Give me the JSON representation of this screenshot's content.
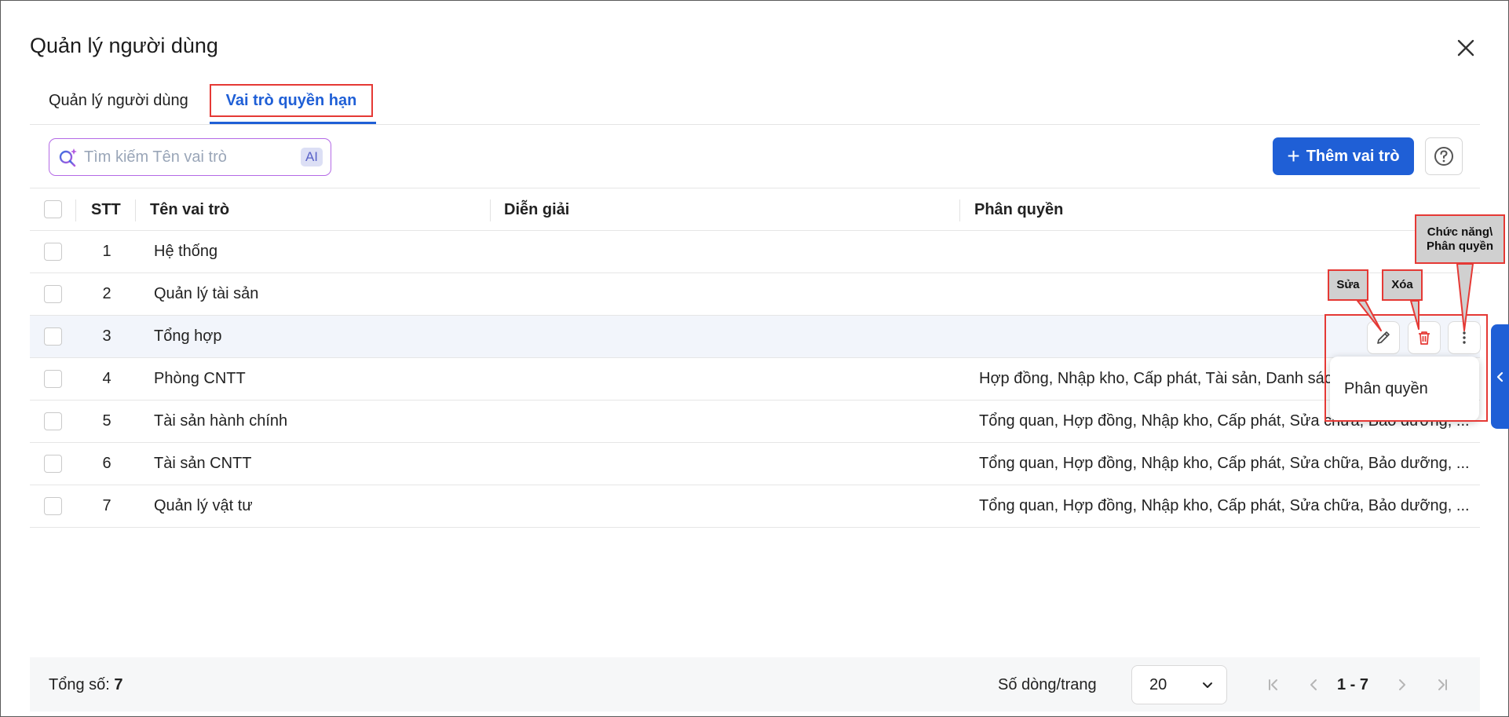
{
  "dialog": {
    "title": "Quản lý người dùng"
  },
  "tabs": [
    {
      "label": "Quản lý người dùng",
      "active": false
    },
    {
      "label": "Vai trò quyền hạn",
      "active": true
    }
  ],
  "search": {
    "placeholder": "Tìm kiếm Tên vai trò",
    "value": "",
    "ai_badge": "AI"
  },
  "toolbar": {
    "add_label": "Thêm vai trò"
  },
  "table": {
    "columns": [
      "STT",
      "Tên vai trò",
      "Diễn giải",
      "Phân quyền"
    ],
    "rows": [
      {
        "stt": "1",
        "name": "Hệ thống",
        "description": "",
        "permissions": ""
      },
      {
        "stt": "2",
        "name": "Quản lý tài sản",
        "description": "",
        "permissions": ""
      },
      {
        "stt": "3",
        "name": "Tổng hợp",
        "description": "",
        "permissions": ""
      },
      {
        "stt": "4",
        "name": "Phòng CNTT",
        "description": "",
        "permissions": "Hợp đồng, Nhập kho, Cấp phát, Tài sản, Danh sách"
      },
      {
        "stt": "5",
        "name": "Tài sản hành chính",
        "description": "",
        "permissions": "Tổng quan, Hợp đồng, Nhập kho, Cấp phát, Sửa chữa, Bảo dưỡng, ..."
      },
      {
        "stt": "6",
        "name": "Tài sản CNTT",
        "description": "",
        "permissions": "Tổng quan, Hợp đồng, Nhập kho, Cấp phát, Sửa chữa, Bảo dưỡng, ..."
      },
      {
        "stt": "7",
        "name": "Quản lý vật tư",
        "description": "",
        "permissions": "Tổng quan, Hợp đồng, Nhập kho, Cấp phát, Sửa chữa, Bảo dưỡng, ..."
      }
    ]
  },
  "row_menu": {
    "item": "Phân quyền"
  },
  "annotations": {
    "edit": "Sửa",
    "delete": "Xóa",
    "function": "Chức năng\\ Phân quyền"
  },
  "footer": {
    "total_label": "Tổng số:",
    "total_value": "7",
    "rows_per_page_label": "Số dòng/trang",
    "rows_per_page_value": "20",
    "range": "1 - 7"
  },
  "colors": {
    "primary": "#1f5fd6",
    "annotation_red": "#e53935",
    "row_highlight": "#f2f5fb"
  },
  "icons": [
    "close-icon",
    "search-sparkle-icon",
    "plus-icon",
    "help-icon",
    "pencil-icon",
    "trash-icon",
    "more-vertical-icon",
    "chevron-left-icon",
    "chevron-down-icon",
    "first-page-icon",
    "prev-page-icon",
    "next-page-icon",
    "last-page-icon"
  ]
}
